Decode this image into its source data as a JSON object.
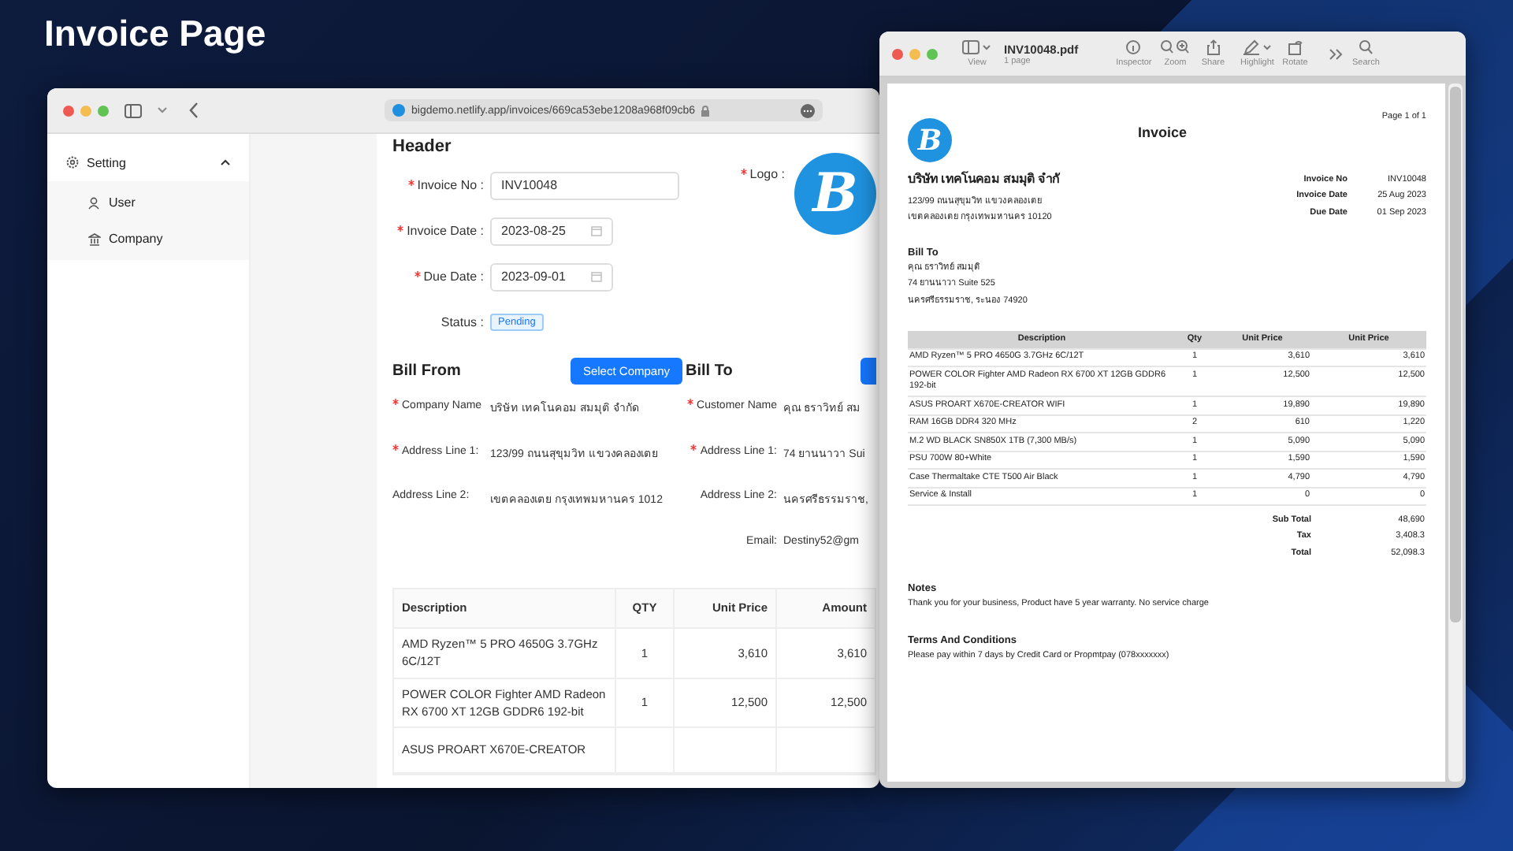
{
  "page_title": "Invoice Page",
  "browser": {
    "url": "bigdemo.netlify.app/invoices/669ca53ebe1208a968f09cb6",
    "sidebar": {
      "items": [
        {
          "label": "Setting",
          "kind": "gear",
          "expanded": true,
          "children": [
            {
              "label": "User",
              "kind": "user"
            },
            {
              "label": "Company",
              "kind": "bank"
            }
          ]
        }
      ]
    },
    "header": {
      "title": "Header",
      "fields": [
        {
          "label": "Invoice No :",
          "required": true,
          "value": "INV10048",
          "kind": "text"
        },
        {
          "label": "Invoice Date :",
          "required": true,
          "value": "2023-08-25",
          "kind": "date"
        },
        {
          "label": "Due Date :",
          "required": true,
          "value": "2023-09-01",
          "kind": "date"
        }
      ],
      "logo_label": "Logo :",
      "logo_required": true,
      "logo_letter": "B",
      "status_label": "Status :",
      "status": "Pending"
    },
    "bill_from": {
      "title": "Bill From",
      "button": "Select Company",
      "fields": [
        {
          "label": "Company Name",
          "required": true,
          "value": "บริษัท เทคโนคอม สมมุติ จำกัด"
        },
        {
          "label": "Address Line 1:",
          "required": true,
          "value": "123/99 ถนนสุขุมวิท แขวงคลองเตย"
        },
        {
          "label": "Address Line 2:",
          "required": false,
          "value": "เขตคลองเตย กรุงเทพมหานคร 1012"
        }
      ]
    },
    "bill_to": {
      "title": "Bill To",
      "fields": [
        {
          "label": "Customer Name",
          "required": true,
          "value": "คุณ ธราวิทย์ สม"
        },
        {
          "label": "Address Line 1:",
          "required": true,
          "value": "74 ยานนาวา Sui"
        },
        {
          "label": "Address Line 2:",
          "required": false,
          "value": "นครศรีธรรมราช,"
        },
        {
          "label": "Email:",
          "required": false,
          "value": "Destiny52@gm"
        }
      ]
    },
    "table": {
      "columns": [
        "Description",
        "QTY",
        "Unit Price",
        "Amount"
      ],
      "rows": [
        [
          "AMD Ryzen™ 5 PRO 4650G 3.7GHz 6C/12T",
          "1",
          "3,610",
          "3,610"
        ],
        [
          "POWER COLOR Fighter AMD Radeon RX 6700 XT 12GB GDDR6 192-bit",
          "1",
          "12,500",
          "12,500"
        ],
        [
          "ASUS PROART X670E-CREATOR"
        ]
      ]
    }
  },
  "pdf_viewer": {
    "file_name": "INV10048.pdf",
    "page_count": "1 page",
    "toolbar": [
      {
        "label": "View",
        "kind": "sidebar"
      },
      {
        "label": "Inspector",
        "kind": "info"
      },
      {
        "label": "Zoom",
        "kind": "zoom"
      },
      {
        "label": "Share",
        "kind": "share"
      },
      {
        "label": "Highlight",
        "kind": "highlight"
      },
      {
        "label": "Rotate",
        "kind": "rotate"
      },
      {
        "label": "Search",
        "kind": "search"
      }
    ],
    "document": {
      "page_number": "Page 1 of 1",
      "title": "Invoice",
      "logo_letter": "B",
      "company_name": "บริษัท เทคโนคอม สมมุติ จำกั",
      "company_address": [
        "123/99 ถนนสุขุมวิท แขวงคลองเตย",
        "เขตคลองเตย กรุงเทพมหานคร 10120"
      ],
      "meta": [
        {
          "label": "Invoice No",
          "value": "INV10048"
        },
        {
          "label": "Invoice Date",
          "value": "25 Aug 2023"
        },
        {
          "label": "Due Date",
          "value": "01 Sep 2023"
        }
      ],
      "bill_to": {
        "title": "Bill To",
        "lines": [
          "คุณ ธราวิทย์ สมมุติ",
          "74 ยานนาวา Suite 525",
          "นครศรีธรรมราช, ระนอง 74920"
        ]
      },
      "table": {
        "columns": [
          "Description",
          "Qty",
          "Unit Price",
          "Unit Price"
        ],
        "rows": [
          [
            "AMD Ryzen™ 5 PRO 4650G 3.7GHz 6C/12T",
            "1",
            "3,610",
            "3,610"
          ],
          [
            "POWER COLOR Fighter AMD Radeon RX 6700 XT 12GB GDDR6 192-bit",
            "1",
            "12,500",
            "12,500"
          ],
          [
            "ASUS PROART X670E-CREATOR WIFI",
            "1",
            "19,890",
            "19,890"
          ],
          [
            "RAM 16GB DDR4 320 MHz",
            "2",
            "610",
            "1,220"
          ],
          [
            "M.2 WD BLACK SN850X 1TB (7,300 MB/s)",
            "1",
            "5,090",
            "5,090"
          ],
          [
            "PSU 700W 80+White",
            "1",
            "1,590",
            "1,590"
          ],
          [
            "Case Thermaltake CTE T500 Air Black",
            "1",
            "4,790",
            "4,790"
          ],
          [
            "Service & Install",
            "1",
            "0",
            "0"
          ]
        ]
      },
      "totals": [
        {
          "label": "Sub Total",
          "value": "48,690"
        },
        {
          "label": "Tax",
          "value": "3,408.3"
        },
        {
          "label": "Total",
          "value": "52,098.3"
        }
      ],
      "notes": {
        "title": "Notes",
        "text": "Thank you for your business, Product have 5 year warranty. No service charge"
      },
      "terms": {
        "title": "Terms And Conditions",
        "text": "Please pay within 7 days by Credit Card or Propmtpay (078xxxxxxx)"
      }
    }
  }
}
